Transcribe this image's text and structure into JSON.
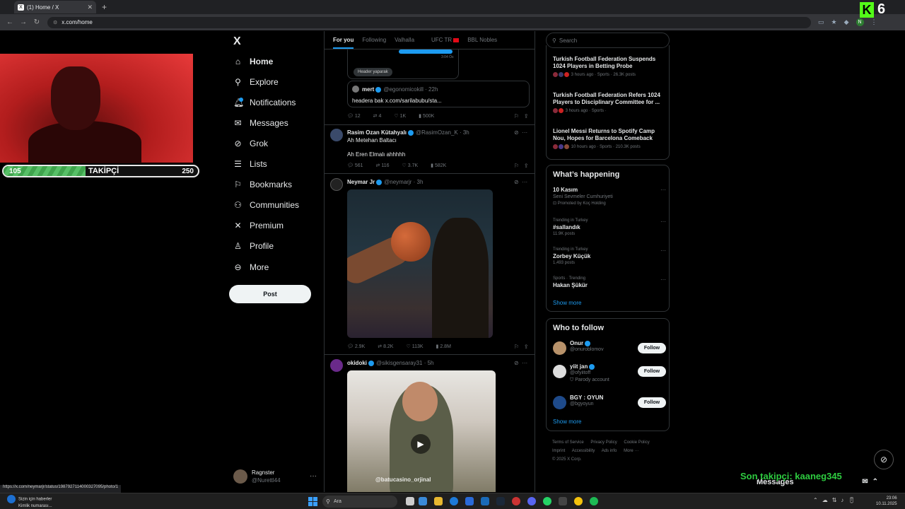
{
  "browser": {
    "tab_title": "(1) Home / X",
    "url": "x.com/home",
    "status_url": "https://x.com/neymarjr/status/1987927114000327095/photo/1"
  },
  "stream": {
    "badge_letter": "K",
    "badge_count": "6",
    "follow_goal": {
      "current": "105",
      "label": "TAKİPÇİ",
      "target": "250",
      "progress": 0.42
    },
    "last_follower": "Son takipçi: kaaneg345"
  },
  "sidebar": {
    "logo": "X",
    "items": [
      {
        "label": "Home",
        "icon": "home-icon"
      },
      {
        "label": "Explore",
        "icon": "search-icon"
      },
      {
        "label": "Notifications",
        "icon": "bell-icon"
      },
      {
        "label": "Messages",
        "icon": "envelope-icon"
      },
      {
        "label": "Grok",
        "icon": "grok-icon"
      },
      {
        "label": "Lists",
        "icon": "list-icon"
      },
      {
        "label": "Bookmarks",
        "icon": "bookmark-icon"
      },
      {
        "label": "Communities",
        "icon": "people-icon"
      },
      {
        "label": "Premium",
        "icon": "x-icon"
      },
      {
        "label": "Profile",
        "icon": "person-icon"
      },
      {
        "label": "More",
        "icon": "more-circle-icon"
      }
    ],
    "post_label": "Post",
    "account": {
      "name": "Ragnster",
      "handle": "@Nurettl44"
    }
  },
  "feed": {
    "tabs": [
      "For you",
      "Following",
      "Valhalla",
      "UFC TR",
      "BBL Nobles"
    ],
    "post0": {
      "time_hint": "3:04 Ös",
      "chip": "Header yaparak",
      "quote": {
        "name": "mert",
        "handle": "@egonomicokill · 22h",
        "text": "headera bak x.com/sarilabubu/sta..."
      },
      "stats": {
        "replies": "12",
        "reposts": "4",
        "likes": "1K",
        "views": "500K"
      }
    },
    "post1": {
      "name": "Rasim Ozan Kütahyalı",
      "handle": "@RasimOzan_K · 3h",
      "line1": "Ah Metehan Baltacı",
      "line2": "Ah Eren Elmalı ahhhhh",
      "stats": {
        "replies": "561",
        "reposts": "116",
        "likes": "3.7K",
        "views": "582K"
      }
    },
    "post2": {
      "name": "Neymar Jr",
      "handle": "@neymarjr · 3h",
      "stats": {
        "replies": "2.9K",
        "reposts": "8.2K",
        "likes": "113K",
        "views": "2.8M"
      }
    },
    "post3": {
      "name": "okidoki",
      "handle": "@sikisgensaray31 · 5h",
      "watermark": "@batucasino_orjinal"
    }
  },
  "right": {
    "search_placeholder": "Search",
    "news": [
      {
        "title": "Turkish Football Federation Suspends 1024 Players in Betting Probe",
        "meta": "3 hours ago · Sports · 26.3K posts"
      },
      {
        "title": "Turkish Football Federation Refers 1024 Players to Disciplinary Committee for ...",
        "meta": "3 hours ago · Sports ·"
      },
      {
        "title": "Lionel Messi Returns to Spotify Camp Nou, Hopes for Barcelona Comeback",
        "meta": "10 hours ago · Sports · 210.3K posts"
      }
    ],
    "happening": {
      "heading": "What’s happening",
      "trends": [
        {
          "context": "",
          "title": "10 Kasım",
          "posts": "Seni Sevmeler Cumhuriyeti",
          "extra": "Promoted by Koç Holding"
        },
        {
          "context": "Trending in Turkey",
          "title": "#sallandık",
          "posts": "11.9K posts",
          "extra": ""
        },
        {
          "context": "Trending in Turkey",
          "title": "Zorbey Küçük",
          "posts": "1,493 posts",
          "extra": ""
        },
        {
          "context": "Sports · Trending",
          "title": "Hakan Şükür",
          "posts": "",
          "extra": ""
        }
      ],
      "show_more": "Show more"
    },
    "who_to_follow": {
      "heading": "Who to follow",
      "people": [
        {
          "name": "Onur",
          "handle": "@onuroblomov",
          "note": ""
        },
        {
          "name": "yiit jan",
          "handle": "@ofyiitoff",
          "note": "Parody account"
        },
        {
          "name": "BGY : OYUN",
          "handle": "@bgyoyun",
          "note": ""
        }
      ],
      "follow_label": "Follow",
      "show_more": "Show more"
    },
    "footer": {
      "links": [
        "Terms of Service",
        "Privacy Policy",
        "Cookie Policy",
        "Imprint",
        "Accessibility",
        "Ads info",
        "More ···"
      ],
      "copyright": "© 2025 X Corp."
    }
  },
  "messages_bar": {
    "label": "Messages"
  },
  "taskbar": {
    "news_title": "Sizin için haberler",
    "news_sub": "Kimlik numarası...",
    "search_label": "Ara",
    "time": "23:06",
    "date": "10.11.2025"
  }
}
